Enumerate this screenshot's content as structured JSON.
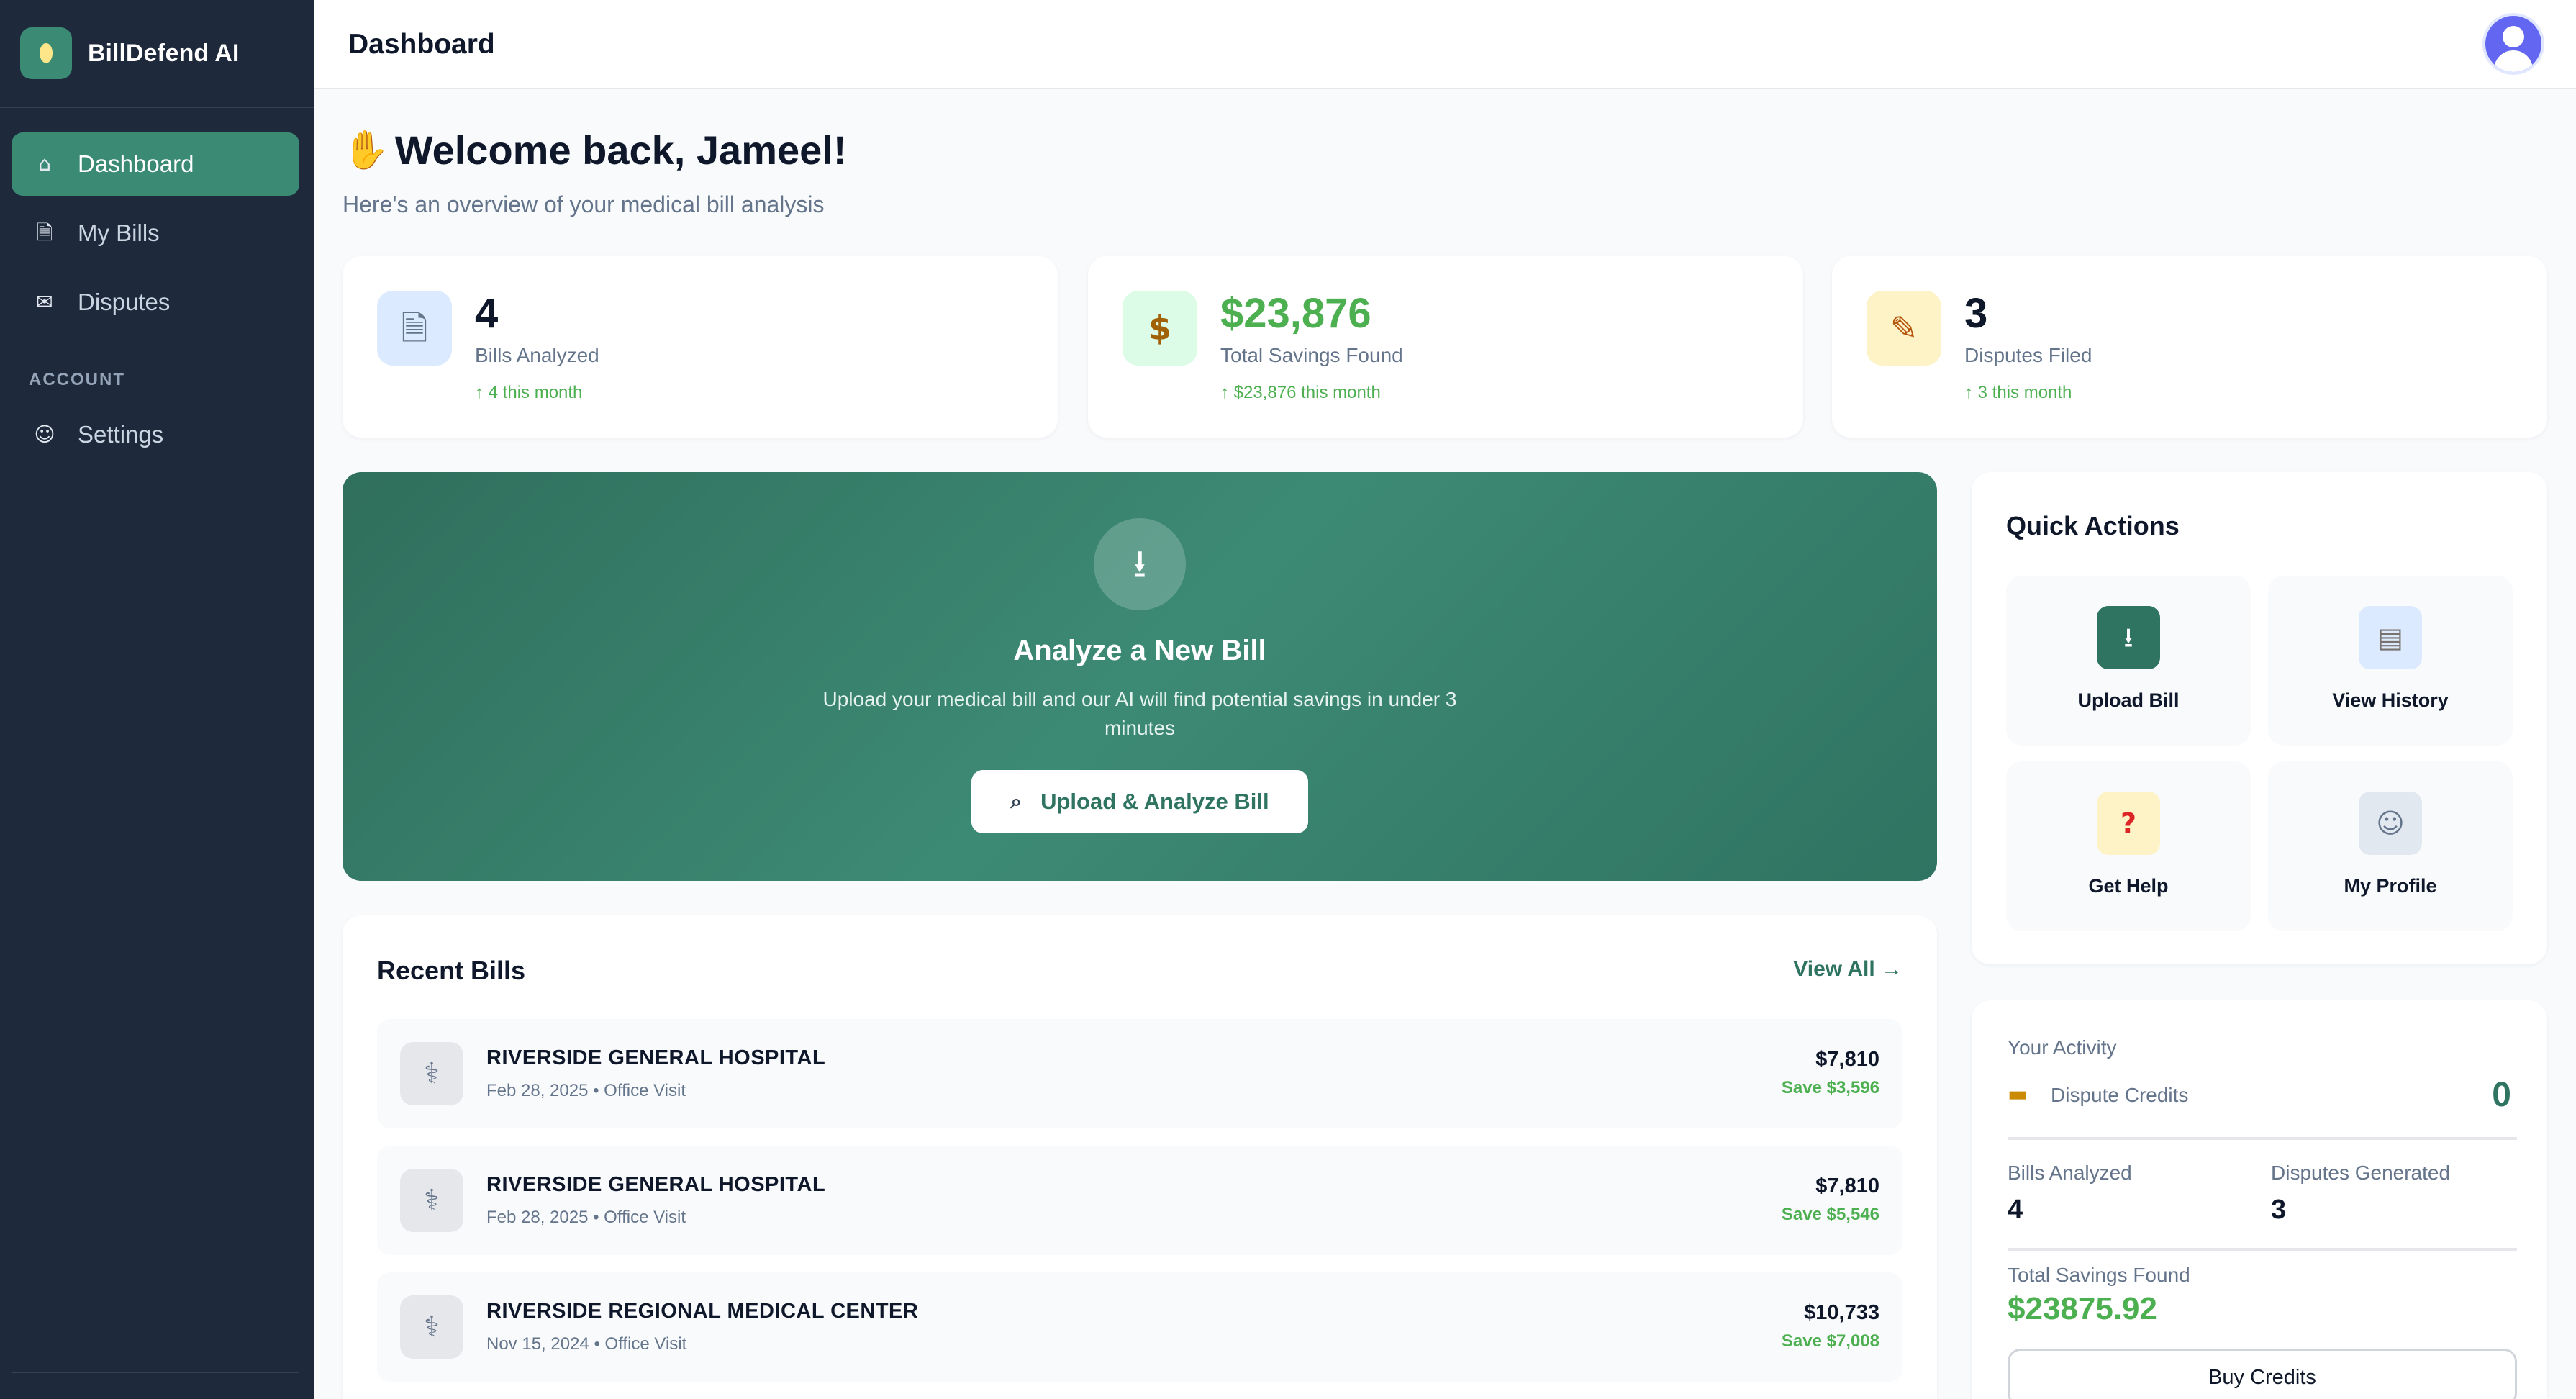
{
  "app": {
    "name": "BillDefend AI",
    "logo_icon": "pill-icon"
  },
  "sidebar": {
    "items": [
      {
        "label": "Dashboard",
        "icon": "house-icon",
        "active": true
      },
      {
        "label": "My Bills",
        "icon": "document-icon"
      },
      {
        "label": "Disputes",
        "icon": "envelope-icon"
      }
    ],
    "section_label": "ACCOUNT",
    "account_items": [
      {
        "label": "Settings",
        "icon": "user-icon"
      }
    ]
  },
  "header": {
    "title": "Dashboard",
    "avatar_icon": "user-avatar-icon"
  },
  "welcome": {
    "emoji": "waving-hand-icon",
    "title": "Welcome back, Jameel!",
    "subtitle": "Here's an overview of your medical bill analysis"
  },
  "stats": [
    {
      "value": "4",
      "label": "Bills Analyzed",
      "trend": "↑ 4 this month",
      "icon": "document-icon",
      "icon_bg": "#dbeafe"
    },
    {
      "value": "$23,876",
      "label": "Total Savings Found",
      "trend": "↑ $23,876 this month",
      "icon": "money-bag-icon",
      "icon_bg": "#dcfce7",
      "value_color": "#4caf50"
    },
    {
      "value": "3",
      "label": "Disputes Filed",
      "trend": "↑ 3 this month",
      "icon": "memo-icon",
      "icon_bg": "#fef3c7"
    }
  ],
  "hero": {
    "icon": "inbox-tray-icon",
    "title": "Analyze a New Bill",
    "description": "Upload your medical bill and our AI will find potential savings in under 3 minutes",
    "button_label": "Upload & Analyze Bill",
    "button_icon": "magnifier-icon"
  },
  "recent_bills": {
    "title": "Recent Bills",
    "view_all": "View All →",
    "items": [
      {
        "name": "RIVERSIDE GENERAL HOSPITAL",
        "meta": "Feb 28, 2025 • Office Visit",
        "amount": "$7,810",
        "save": "Save $3,596",
        "icon": "stethoscope-icon"
      },
      {
        "name": "RIVERSIDE GENERAL HOSPITAL",
        "meta": "Feb 28, 2025 • Office Visit",
        "amount": "$7,810",
        "save": "Save $5,546",
        "icon": "stethoscope-icon"
      },
      {
        "name": "RIVERSIDE REGIONAL MEDICAL CENTER",
        "meta": "Nov 15, 2024 • Office Visit",
        "amount": "$10,733",
        "save": "Save $7,008",
        "icon": "stethoscope-icon"
      }
    ]
  },
  "quick_actions": {
    "title": "Quick Actions",
    "items": [
      {
        "label": "Upload Bill",
        "icon": "inbox-tray-icon",
        "bg": "#2f7361"
      },
      {
        "label": "View History",
        "icon": "clipboard-icon",
        "bg": "#dbeafe"
      },
      {
        "label": "Get Help",
        "icon": "question-mark-icon",
        "bg": "#fef3c7"
      },
      {
        "label": "My Profile",
        "icon": "user-icon",
        "bg": "#e2e8f0"
      }
    ]
  },
  "activity": {
    "heading": "Your Activity",
    "credits_label": "Dispute Credits",
    "credits_icon": "ticket-icon",
    "credits_value": "0",
    "bills_analyzed_label": "Bills Analyzed",
    "bills_analyzed_value": "4",
    "disputes_generated_label": "Disputes Generated",
    "disputes_generated_value": "3",
    "total_savings_label": "Total Savings Found",
    "total_savings_value": "$23875.92",
    "buy_button": "Buy Credits"
  }
}
